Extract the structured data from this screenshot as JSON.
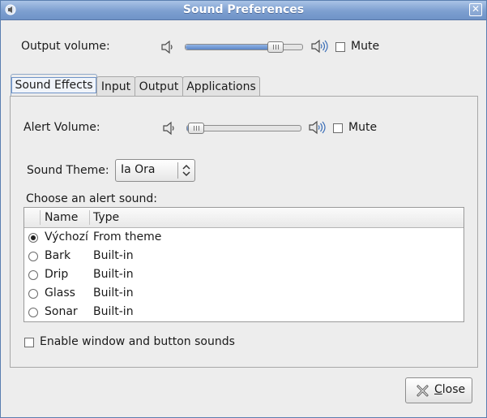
{
  "window": {
    "title": "Sound Preferences",
    "close_glyph": "✕"
  },
  "output": {
    "label": "Output volume:",
    "volume_level": 0.78,
    "mute_label": "Mute",
    "muted": false
  },
  "tabs": [
    {
      "label": "Sound Effects",
      "active": true
    },
    {
      "label": "Input",
      "active": false
    },
    {
      "label": "Output",
      "active": false
    },
    {
      "label": "Applications",
      "active": false
    }
  ],
  "sound_effects": {
    "alert_label": "Alert Volume:",
    "alert_level": 0.02,
    "mute_label": "Mute",
    "muted": false,
    "theme_label": "Sound Theme:",
    "theme_value": "Ia Ora",
    "choose_label": "Choose an alert sound:",
    "columns": {
      "name": "Name",
      "type": "Type"
    },
    "sounds": [
      {
        "name": "Výchozí",
        "type": "From theme",
        "selected": true
      },
      {
        "name": "Bark",
        "type": "Built-in",
        "selected": false
      },
      {
        "name": "Drip",
        "type": "Built-in",
        "selected": false
      },
      {
        "name": "Glass",
        "type": "Built-in",
        "selected": false
      },
      {
        "name": "Sonar",
        "type": "Built-in",
        "selected": false
      }
    ],
    "enable_sounds_label": "Enable window and button sounds",
    "enable_sounds_checked": false
  },
  "footer": {
    "close_prefix": "",
    "close_mnemonic": "C",
    "close_rest": "lose"
  },
  "colors": {
    "titlebar": "#7d9fd0",
    "slider_fill": "#5b86c8",
    "window_bg": "#ededed"
  },
  "icons": {
    "window": "speaker-icon",
    "volume_low": "speaker-low-icon",
    "volume_high": "speaker-high-icon",
    "combo": "updown-arrows-icon",
    "close": "close-x-icon"
  }
}
